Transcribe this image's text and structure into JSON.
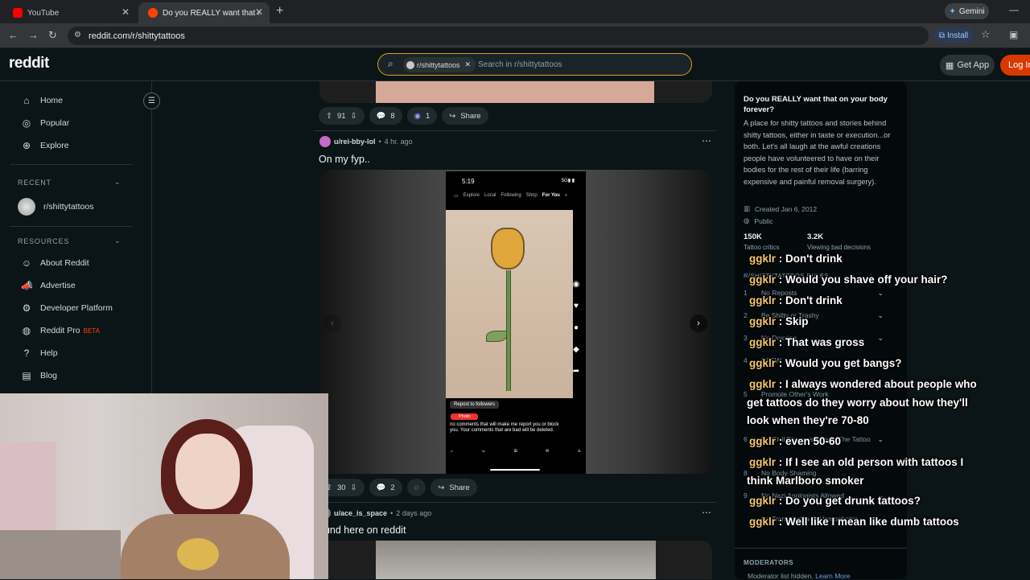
{
  "browser": {
    "tabs": [
      {
        "title": "YouTube",
        "favicon_color": "#ff0000"
      },
      {
        "title": "Do you REALLY want that on yo",
        "favicon_color": "#ff4500"
      }
    ],
    "new_tab_glyph": "+",
    "gemini_label": "Gemini",
    "url": "reddit.com/r/shittytattoos",
    "install_label": "Install"
  },
  "header": {
    "logo": "reddit",
    "search_chip": "r/shittytattoos",
    "search_placeholder": "Search in r/shittytattoos",
    "get_app_label": "Get App",
    "login_label": "Log In"
  },
  "sidebar": {
    "nav": [
      {
        "label": "Home",
        "icon": "home-icon",
        "glyph": "⌂"
      },
      {
        "label": "Popular",
        "icon": "popular-icon",
        "glyph": "◎"
      },
      {
        "label": "Explore",
        "icon": "explore-icon",
        "glyph": "⊕"
      }
    ],
    "recent_heading": "RECENT",
    "recent_items": [
      {
        "label": "r/shittytattoos"
      }
    ],
    "resources_heading": "RESOURCES",
    "resources": [
      {
        "label": "About Reddit",
        "icon": "about-reddit-icon",
        "glyph": "☺"
      },
      {
        "label": "Advertise",
        "icon": "advertise-icon",
        "glyph": "📣"
      },
      {
        "label": "Developer Platform",
        "icon": "developer-platform-icon",
        "glyph": "⚙"
      },
      {
        "label": "Reddit Pro",
        "icon": "reddit-pro-icon",
        "glyph": "◍",
        "badge": "BETA"
      },
      {
        "label": "Help",
        "icon": "help-icon",
        "glyph": "?"
      },
      {
        "label": "Blog",
        "icon": "blog-icon",
        "glyph": "▤"
      }
    ]
  },
  "feed": {
    "prev_post_actions": {
      "upvotes": "91",
      "comments": "8",
      "awards": "1",
      "share": "Share"
    },
    "post": {
      "user": "u/rei-bby-lol",
      "time": "4 hr. ago",
      "title": "On my fyp..",
      "upvotes": "30",
      "comments": "2",
      "share": "Share",
      "phone": {
        "time": "5:19",
        "status": "5G▮ ▮",
        "tabs": [
          "Explore",
          "Local",
          "Following",
          "Shop",
          "For You"
        ],
        "active_tab": "For You",
        "repost": "Repost to followers",
        "photo_chip": "Photo",
        "caption": "no comments that will make me report you or block you. Your comments that are bad will be deleted."
      }
    },
    "next_post": {
      "user": "u/ace_is_space",
      "time": "2 days ago",
      "title": "ound here on reddit"
    }
  },
  "right_sidebar": {
    "title": "Do you REALLY want that on your body forever?",
    "description": "A place for shitty tattoos and stories behind shitty tattoos, either in taste or execution...or both. Let's all laugh at the awful creations people have volunteered to have on their bodies for the rest of their life (barring expensive and painful removal surgery).",
    "created": "Created Jan 6, 2012",
    "visibility": "Public",
    "stats": [
      {
        "value": "150K",
        "label": "Tattoo critics"
      },
      {
        "value": "3.2K",
        "label": "Viewing bad decisions"
      }
    ],
    "rules_heading": "R/SHITTYTATTOOS RULES",
    "rules": [
      {
        "num": "1",
        "text": "No Reposts"
      },
      {
        "num": "2",
        "text": "Be Shitty or Trashy"
      },
      {
        "num": "3",
        "text": "No Doxxing"
      },
      {
        "num": "4",
        "text": "NSFW"
      },
      {
        "num": "5",
        "text": "Promote Other's Work"
      },
      {
        "num": "6",
        "text": "No Civil Discourse About The Tattoo"
      },
      {
        "num": "8",
        "text": "No Body Shaming"
      },
      {
        "num": "9",
        "text": "No Nazi Apologists Allowed"
      },
      {
        "num": "",
        "text": "No Transphobia or Homophobia"
      }
    ],
    "moderators_heading": "MODERATORS",
    "moderators_text": "Moderator list hidden.",
    "learn_more": "Learn More"
  },
  "chat": {
    "username": "ggklr",
    "messages": [
      {
        "text": "Don't drink"
      },
      {
        "text": "Would you shave off your hair?"
      },
      {
        "text": "Don't drink"
      },
      {
        "text": "Skip"
      },
      {
        "text": "That was gross"
      },
      {
        "text": "Would you get bangs?"
      },
      {
        "text": "I always wondered about people who get tattoos do they worry about how they'll look when they're 70-80"
      },
      {
        "text": "even 50-60"
      },
      {
        "text": "If I see an old person with tattoos I think Marlboro smoker"
      },
      {
        "text": "Do you get drunk tattoos?"
      },
      {
        "text": "Well like I mean like dumb tattoos"
      }
    ]
  }
}
